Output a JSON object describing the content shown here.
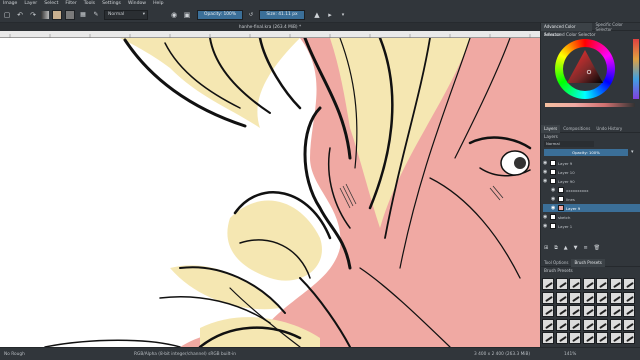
{
  "menu": [
    "Image",
    "Layer",
    "Select",
    "Filter",
    "Tools",
    "Settings",
    "Window",
    "Help"
  ],
  "toolbar": {
    "preset_label": "Normal",
    "opacity_label": "Opacity: 100%",
    "size_label": "Size: 41.11 px",
    "fg_color": "#c9b08f",
    "bg_color": "#7a7a7a"
  },
  "document_tab": "hanhe-final.kra (263.4 MiB) *",
  "dock": {
    "top_tabs": [
      "Advanced Color Selector",
      "Specific Color Selector"
    ],
    "panel_title": "Advanced Color Selector",
    "layers_tabs": [
      "Layers",
      "Compositions",
      "Undo History"
    ],
    "layers_title": "Layers",
    "blend_mode": "Normal",
    "opacity": "Opacity: 100%",
    "layers": [
      {
        "name": "Layer 9"
      },
      {
        "name": "Layer 10"
      },
      {
        "name": "Layer 90"
      },
      {
        "name": "xxxxxxxxxx"
      },
      {
        "name": "lines"
      },
      {
        "name": "Layer 9"
      },
      {
        "name": "sketch"
      },
      {
        "name": "Layer 1"
      }
    ],
    "bottom_tabs": [
      "Tool Options",
      "Brush Presets"
    ],
    "brush_title": "Brush Presets"
  },
  "status": {
    "tool": "No Rough",
    "color_info": "RGB/Alpha (8-bit integer/channel)  sRGB built-in",
    "dimensions": "3 400 x 2 400 (263.3 MiB)",
    "zoom": "141%"
  },
  "colors": {
    "skin": "#f0a9a3",
    "hair": "#f5e7b2",
    "ink": "#111111",
    "accent_blue": "#3b6f98"
  }
}
